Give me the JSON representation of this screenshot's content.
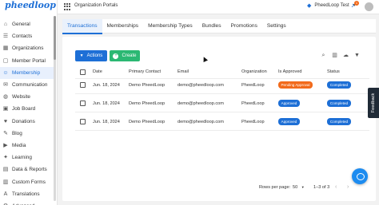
{
  "app": {
    "logo_text": "pheedloop",
    "logo_sub": "Beta",
    "page_title": "Organization Portals"
  },
  "topbar": {
    "event_name": "PheedLoop Test",
    "notification_count": "1"
  },
  "sidebar": {
    "items": [
      {
        "label": "General",
        "icon": "home-icon",
        "glyph": "⌂"
      },
      {
        "label": "Contacts",
        "icon": "contacts-icon",
        "glyph": "☰"
      },
      {
        "label": "Organizations",
        "icon": "organizations-icon",
        "glyph": "▦"
      },
      {
        "label": "Member Portal",
        "icon": "member-portal-icon",
        "glyph": "▢"
      },
      {
        "label": "Membership",
        "icon": "membership-icon",
        "glyph": "☺",
        "active": true
      },
      {
        "label": "Communication",
        "icon": "communication-icon",
        "glyph": "✉"
      },
      {
        "label": "Website",
        "icon": "website-icon",
        "glyph": "◍"
      },
      {
        "label": "Job Board",
        "icon": "job-board-icon",
        "glyph": "▣"
      },
      {
        "label": "Donations",
        "icon": "donations-icon",
        "glyph": "♥"
      },
      {
        "label": "Blog",
        "icon": "blog-icon",
        "glyph": "✎"
      },
      {
        "label": "Media",
        "icon": "media-icon",
        "glyph": "▶"
      },
      {
        "label": "Learning",
        "icon": "learning-icon",
        "glyph": "✦"
      },
      {
        "label": "Data & Reports",
        "icon": "reports-icon",
        "glyph": "▤"
      },
      {
        "label": "Custom Forms",
        "icon": "forms-icon",
        "glyph": "▥"
      },
      {
        "label": "Translations",
        "icon": "translations-icon",
        "glyph": "A"
      },
      {
        "label": "Advanced",
        "icon": "advanced-icon",
        "glyph": "⚙"
      }
    ]
  },
  "tabs": [
    "Transactions",
    "Memberships",
    "Membership Types",
    "Bundles",
    "Promotions",
    "Settings"
  ],
  "toolbar": {
    "actions_label": "Actions",
    "create_label": "Create"
  },
  "table": {
    "columns": [
      "Date",
      "Primary Contact",
      "Email",
      "Organization",
      "Is Approved",
      "Status"
    ],
    "rows": [
      {
        "date": "Jun. 18, 2024",
        "contact": "Demo PheedLoop",
        "email": "demo@pheedloop.com",
        "organization": "PheedLoop",
        "approved": "Pending Approval",
        "status": "Completed"
      },
      {
        "date": "Jun. 18, 2024",
        "contact": "Demo PheedLoop",
        "email": "demo@pheedloop.com",
        "organization": "PheedLoop",
        "approved": "Approved",
        "status": "Completed"
      },
      {
        "date": "Jun. 18, 2024",
        "contact": "Demo PheedLoop",
        "email": "demo@pheedloop.com",
        "organization": "PheedLoop",
        "approved": "Approved",
        "status": "Completed"
      }
    ]
  },
  "pagination": {
    "rows_per_page_label": "Rows per page:",
    "rows_per_page_value": "50",
    "range": "1–3 of 3"
  },
  "feedback_label": "Feedback",
  "colors": {
    "primary": "#1d6fd6",
    "create": "#2bb873",
    "pending": "#f26a1b",
    "approved": "#1d6fd6"
  }
}
